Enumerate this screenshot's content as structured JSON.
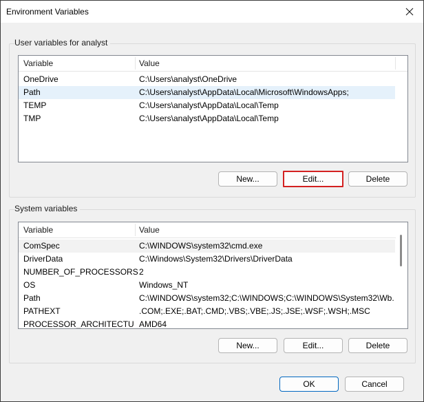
{
  "window": {
    "title": "Environment Variables"
  },
  "user_group": {
    "label": "User variables for analyst",
    "columns": [
      "Variable",
      "Value"
    ],
    "rows": [
      {
        "variable": "OneDrive",
        "value": "C:\\Users\\analyst\\OneDrive"
      },
      {
        "variable": "Path",
        "value": "C:\\Users\\analyst\\AppData\\Local\\Microsoft\\WindowsApps;"
      },
      {
        "variable": "TEMP",
        "value": "C:\\Users\\analyst\\AppData\\Local\\Temp"
      },
      {
        "variable": "TMP",
        "value": "C:\\Users\\analyst\\AppData\\Local\\Temp"
      }
    ],
    "selected_row": "Path",
    "buttons": {
      "new": "New...",
      "edit": "Edit...",
      "delete": "Delete"
    }
  },
  "system_group": {
    "label": "System variables",
    "columns": [
      "Variable",
      "Value"
    ],
    "rows": [
      {
        "variable": "ComSpec",
        "value": "C:\\WINDOWS\\system32\\cmd.exe"
      },
      {
        "variable": "DriverData",
        "value": "C:\\Windows\\System32\\Drivers\\DriverData"
      },
      {
        "variable": "NUMBER_OF_PROCESSORS",
        "value": "2"
      },
      {
        "variable": "OS",
        "value": "Windows_NT"
      },
      {
        "variable": "Path",
        "value": "C:\\WINDOWS\\system32;C:\\WINDOWS;C:\\WINDOWS\\System32\\Wb..."
      },
      {
        "variable": "PATHEXT",
        "value": ".COM;.EXE;.BAT;.CMD;.VBS;.VBE;.JS;.JSE;.WSF;.WSH;.MSC"
      },
      {
        "variable": "PROCESSOR_ARCHITECTURE",
        "value": "AMD64"
      }
    ],
    "highlighted_row": "ComSpec",
    "buttons": {
      "new": "New...",
      "edit": "Edit...",
      "delete": "Delete"
    }
  },
  "footer": {
    "ok": "OK",
    "cancel": "Cancel"
  },
  "icons": {
    "close": "close-icon"
  },
  "colors": {
    "focus_border": "#d32020",
    "default_border": "#0067c0",
    "selection": "#e5f1fb"
  }
}
